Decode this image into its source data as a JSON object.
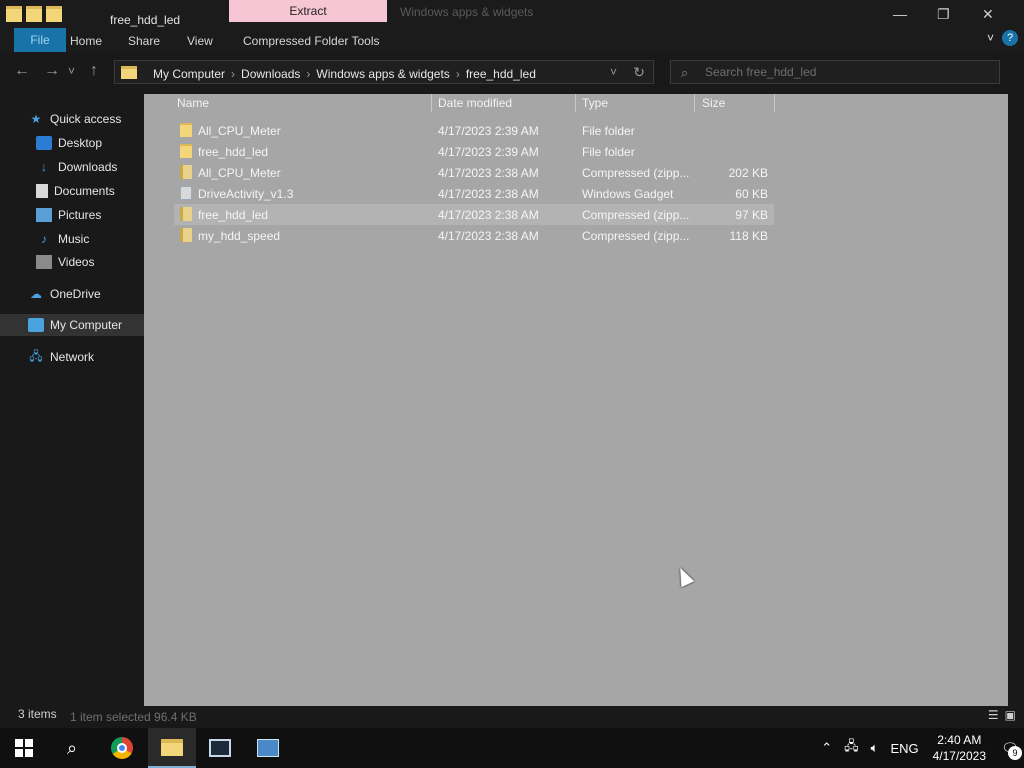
{
  "window": {
    "title": "free_hdd_led",
    "context_tab": "Extract",
    "ghost_title": "Windows apps & widgets",
    "minimize": "—",
    "maximize": "❐",
    "close": "✕"
  },
  "ribbon": {
    "tabs": [
      "File",
      "Home",
      "Share",
      "View",
      "Compressed Folder Tools"
    ],
    "help": "?"
  },
  "address": {
    "back": "←",
    "forward": "→",
    "recent": "˅",
    "up": "↑",
    "crumbs": [
      "My Computer",
      "Downloads",
      "Windows apps & widgets",
      "free_hdd_led"
    ],
    "separator": "›",
    "dropdown": "˅",
    "refresh": "↻"
  },
  "search": {
    "placeholder": "Search free_hdd_led"
  },
  "nav": {
    "items": [
      {
        "label": "Quick access",
        "icon": "star-icon",
        "pinned": false
      },
      {
        "label": "Desktop",
        "icon": "desktop-icon",
        "pinned": true
      },
      {
        "label": "Downloads",
        "icon": "download-icon",
        "pinned": true
      },
      {
        "label": "Documents",
        "icon": "document-icon",
        "pinned": true
      },
      {
        "label": "Pictures",
        "icon": "pictures-icon",
        "pinned": true
      },
      {
        "label": "Music",
        "icon": "music-icon",
        "pinned": false
      },
      {
        "label": "Videos",
        "icon": "videos-icon",
        "pinned": false
      },
      {
        "label": "OneDrive",
        "icon": "cloud-icon",
        "pinned": false
      },
      {
        "label": "My Computer",
        "icon": "computer-icon",
        "pinned": false,
        "selected": true
      },
      {
        "label": "Network",
        "icon": "network-icon",
        "pinned": false
      }
    ]
  },
  "columns": [
    "Name",
    "Date modified",
    "Type",
    "Size"
  ],
  "files": [
    {
      "name": "All_CPU_Meter",
      "date": "4/17/2023 2:39 AM",
      "type": "File folder",
      "size": "",
      "icon": "folder-icon"
    },
    {
      "name": "free_hdd_led",
      "date": "4/17/2023 2:39 AM",
      "type": "File folder",
      "size": "",
      "icon": "folder-icon"
    },
    {
      "name": "All_CPU_Meter",
      "date": "4/17/2023 2:38 AM",
      "type": "Compressed (zipp...",
      "size": "202 KB",
      "icon": "zip-icon"
    },
    {
      "name": "DriveActivity_v1.3",
      "date": "4/17/2023 2:38 AM",
      "type": "Windows Gadget",
      "size": "60 KB",
      "icon": "gadget-icon"
    },
    {
      "name": "free_hdd_led",
      "date": "4/17/2023 2:38 AM",
      "type": "Compressed (zipp...",
      "size": "97 KB",
      "icon": "zip-icon",
      "highlighted": true
    },
    {
      "name": "my_hdd_speed",
      "date": "4/17/2023 2:38 AM",
      "type": "Compressed (zipp...",
      "size": "118 KB",
      "icon": "zip-icon"
    }
  ],
  "status": {
    "items": "3 items",
    "selection": "1 item selected  96.4 KB"
  },
  "taskbar": {
    "language": "ENG",
    "time": "2:40 AM",
    "date": "4/17/2023",
    "notifications": "9"
  }
}
